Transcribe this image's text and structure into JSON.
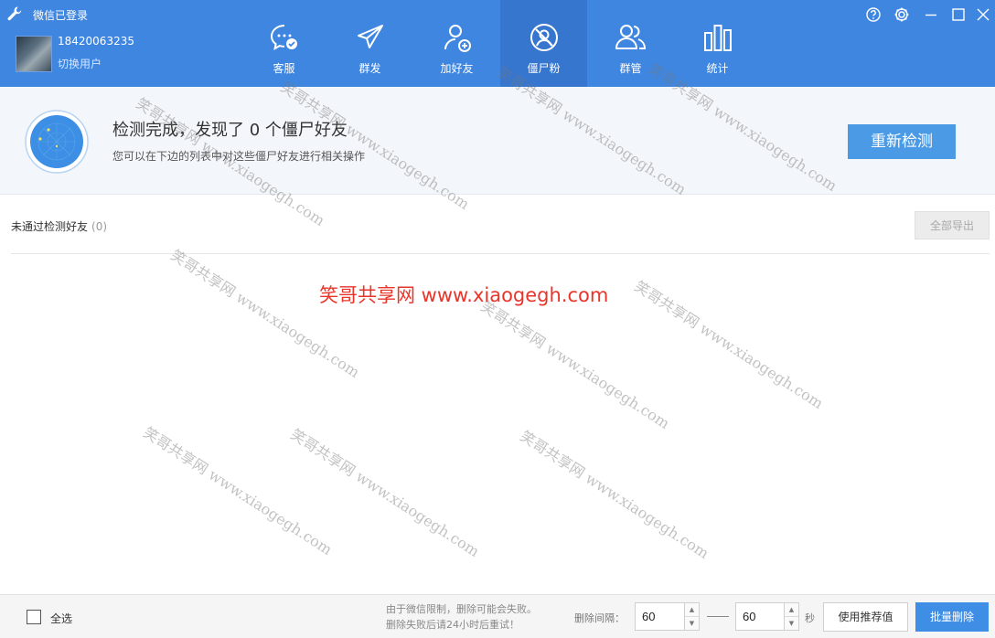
{
  "header": {
    "title": "微信已登录",
    "phone": "18420063235",
    "switch_user": "切换用户",
    "tabs": [
      {
        "label": "客服",
        "icon": "chat-bubble-icon"
      },
      {
        "label": "群发",
        "icon": "paper-plane-icon"
      },
      {
        "label": "加好友",
        "icon": "add-friend-icon"
      },
      {
        "label": "僵尸粉",
        "icon": "zombie-fan-icon",
        "active": true
      },
      {
        "label": "群管",
        "icon": "group-manage-icon"
      },
      {
        "label": "统计",
        "icon": "bar-stats-icon"
      }
    ]
  },
  "banner": {
    "title": "检测完成，发现了 0 个僵尸好友",
    "subtitle": "您可以在下边的列表中对这些僵尸好友进行相关操作",
    "redetect_label": "重新检测"
  },
  "list": {
    "title": "未通过检测好友",
    "count": "(0)",
    "export_label": "全部导出"
  },
  "watermark": {
    "text": "笑哥共享网 www.xiaogegh.com",
    "center_text": "笑哥共享网 www.xiaogegh.com"
  },
  "footer": {
    "select_all": "全选",
    "note_line1": "由于微信限制，删除可能会失败。",
    "note_line2": "删除失败后请24小时后重试！",
    "interval_label": "删除间隔：",
    "interval_min": "60",
    "interval_max": "60",
    "seconds": "秒",
    "use_recommended": "使用推荐值",
    "batch_delete": "批量删除"
  },
  "colors": {
    "header_bg": "#3f86e0",
    "active_tab_bg": "#3676cf",
    "primary_button": "#4a9ae6",
    "watermark_center": "#e8352a"
  }
}
